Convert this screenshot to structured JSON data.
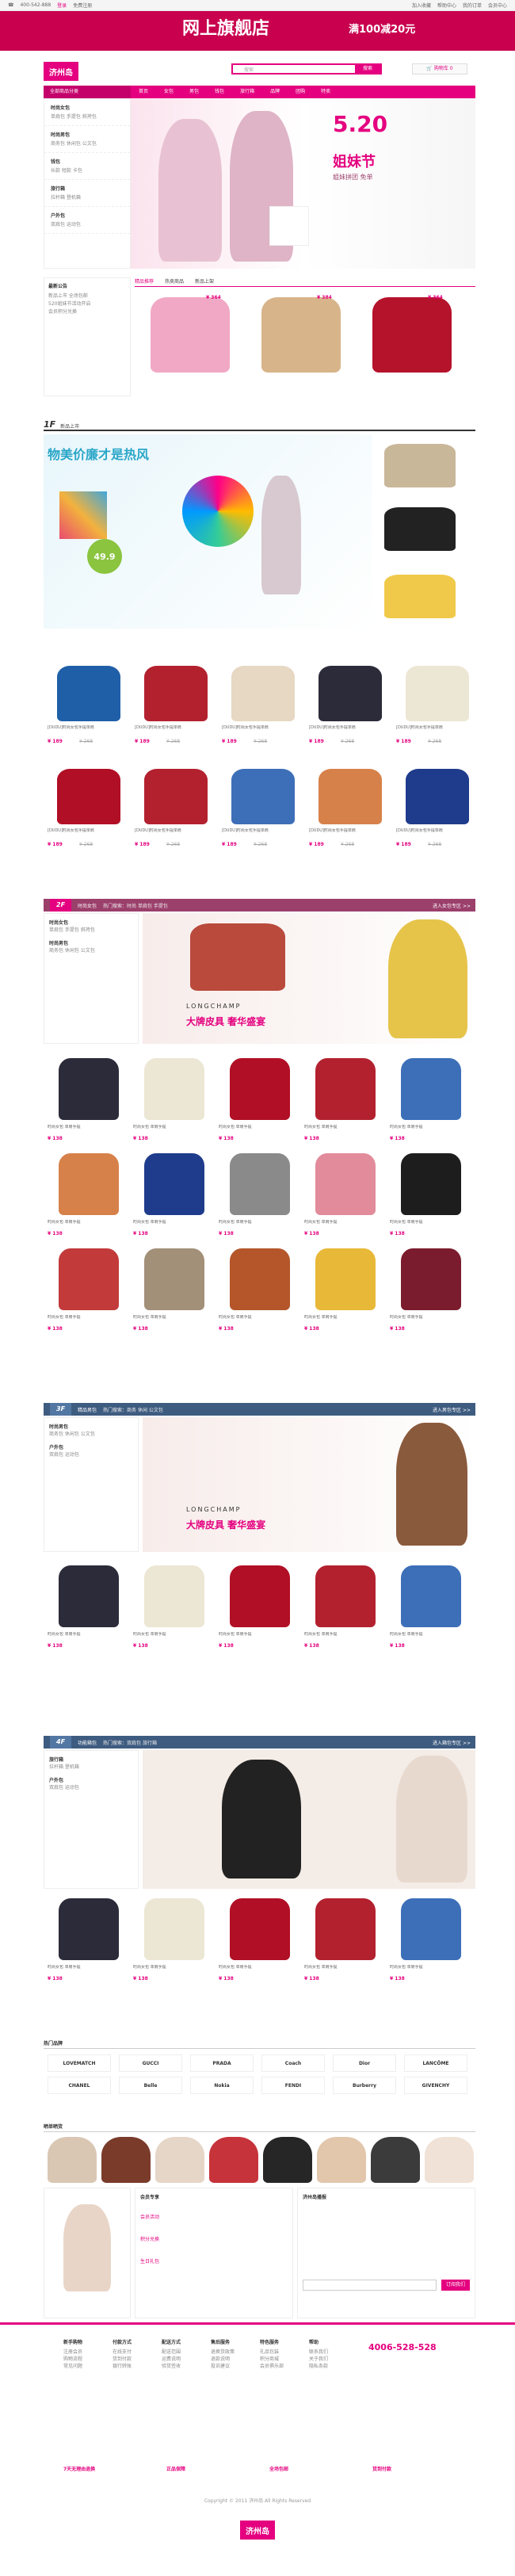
{
  "topbar": {
    "phone": "400-542-888",
    "links": [
      "加入收藏",
      "帮助中心",
      "我的订单",
      "会员中心"
    ],
    "login": "登录",
    "register": "免费注册"
  },
  "banner": {
    "title": "网上旗舰店",
    "sub": "满100减20元"
  },
  "header": {
    "logo": "济州岛",
    "search_placeholder": "搜索",
    "search_button": "搜索",
    "cart": "购物车 0"
  },
  "nav": {
    "category": "全部商品分类",
    "items": [
      "首页",
      "女包",
      "男包",
      "钱包",
      "旅行箱",
      "品牌",
      "团购",
      "特卖"
    ]
  },
  "sidebar": [
    {
      "title": "时尚女包",
      "links": "单肩包 手提包 斜挎包"
    },
    {
      "title": "时尚男包",
      "links": "商务包 休闲包 公文包"
    },
    {
      "title": "钱包",
      "links": "长款 短款 卡包"
    },
    {
      "title": "旅行箱",
      "links": "拉杆箱 登机箱"
    },
    {
      "title": "户外包",
      "links": "双肩包 运动包"
    }
  ],
  "hero": {
    "title": "5.20",
    "slogan": "姐妹节",
    "sub": "姐妹拼团 免单"
  },
  "brand_block": {
    "title": "最新公告",
    "items": [
      "新品上市 全场包邮",
      "520姐妹节活动开启",
      "会员积分兑换"
    ],
    "tabs": [
      "精品推荐",
      "热卖商品",
      "新品上架"
    ]
  },
  "feature_prices": [
    "¥ 364",
    "¥ 384",
    "¥ 364"
  ],
  "section1": {
    "tag": "1F",
    "label": "新品上市",
    "promo_title": "物美价廉才是热风",
    "promo_price": "49.9"
  },
  "products1": [
    {
      "cap": "[DUDU]时尚女包手提单肩",
      "price": "¥ 189",
      "old": "¥ 268"
    },
    {
      "cap": "[DUDU]时尚女包手提单肩",
      "price": "¥ 189",
      "old": "¥ 268"
    },
    {
      "cap": "[DUDU]时尚女包手提单肩",
      "price": "¥ 189",
      "old": "¥ 268"
    },
    {
      "cap": "[DUDU]时尚女包手提单肩",
      "price": "¥ 189",
      "old": "¥ 268"
    },
    {
      "cap": "[DUDU]时尚女包手提单肩",
      "price": "¥ 189",
      "old": "¥ 268"
    },
    {
      "cap": "[DUDU]时尚女包手提单肩",
      "price": "¥ 189",
      "old": "¥ 268"
    },
    {
      "cap": "[DUDU]时尚女包手提单肩",
      "price": "¥ 189",
      "old": "¥ 268"
    },
    {
      "cap": "[DUDU]时尚女包手提单肩",
      "price": "¥ 189",
      "old": "¥ 268"
    },
    {
      "cap": "[DUDU]时尚女包手提单肩",
      "price": "¥ 189",
      "old": "¥ 268"
    },
    {
      "cap": "[DUDU]时尚女包手提单肩",
      "price": "¥ 189",
      "old": "¥ 268"
    }
  ],
  "section2": {
    "tag": "2F",
    "label": "时尚女包",
    "links": "热门搜索：时尚 单肩包 手提包",
    "more": "进入女包专区 >>",
    "ad": "大牌皮具 奢华盛宴",
    "brand": "LONGCHAMP"
  },
  "section3": {
    "tag": "3F",
    "label": "精品男包",
    "links": "热门搜索：商务 休闲 公文包",
    "more": "进入男包专区 >>",
    "ad": "大牌皮具 奢华盛宴",
    "brand": "LONGCHAMP"
  },
  "section4": {
    "tag": "4F",
    "label": "功能箱包",
    "links": "热门搜索：双肩包 旅行箱",
    "more": "进入箱包专区 >>"
  },
  "grid_caption": "时尚女包 单肩手提",
  "grid_price": "¥ 138",
  "brands_title": "热门品牌",
  "brands": [
    "LOVEMATCH",
    "GUCCI",
    "PRADA",
    "Coach",
    "Dior",
    "LANCÔME",
    "CHANEL",
    "Belle",
    "Nokia",
    "FENDI",
    "Burberry",
    "GIVENCHY"
  ],
  "show_title": "晒单晒货",
  "member": {
    "title": "会员专享",
    "items": [
      "会员活动",
      "积分兑换",
      "生日礼包"
    ]
  },
  "app": {
    "title": "济州岛播报",
    "phone": "4006-528-528",
    "btn": "订阅我们"
  },
  "footer": [
    {
      "h": "新手购物",
      "l": [
        "注册会员",
        "购物流程",
        "常见问题"
      ]
    },
    {
      "h": "付款方式",
      "l": [
        "在线支付",
        "货到付款",
        "银行转账"
      ]
    },
    {
      "h": "配送方式",
      "l": [
        "配送范围",
        "运费说明",
        "验货签收"
      ]
    },
    {
      "h": "售后服务",
      "l": [
        "退换货政策",
        "退款说明",
        "投诉建议"
      ]
    },
    {
      "h": "特色服务",
      "l": [
        "礼品包装",
        "积分商城",
        "会员俱乐部"
      ]
    },
    {
      "h": "帮助",
      "l": [
        "联系我们",
        "关于我们",
        "隐私条款"
      ]
    }
  ],
  "service": [
    "7天无理由退换",
    "正品保障",
    "全场包邮",
    "货到付款"
  ],
  "copyright": "Copyright © 2011 济州岛 All Rights Reserved",
  "colors": {
    "accent": "#e4007f",
    "dark": "#9b3f6b"
  }
}
